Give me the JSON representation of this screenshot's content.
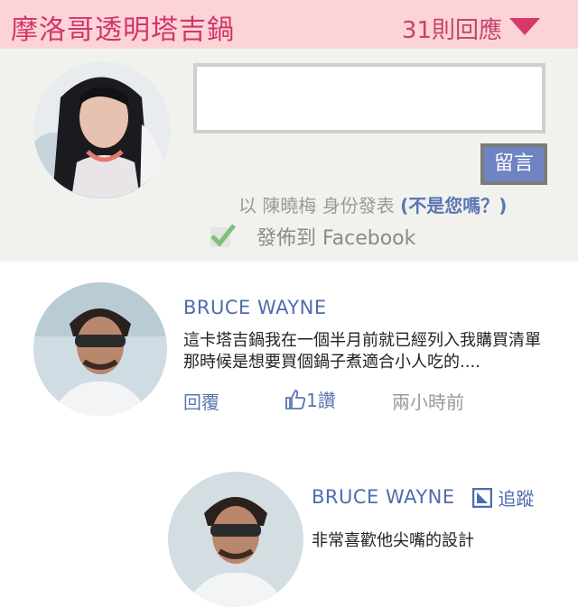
{
  "header": {
    "title": "摩洛哥透明塔吉鍋",
    "comment_count": "31則回應",
    "accent_color": "#d1356c",
    "background_color": "#fcd3d6",
    "caret_icon": "caret-down-icon"
  },
  "compose": {
    "input_value": "",
    "post_label": "留言",
    "identity_prefix": "以 陳曉梅 身份發表",
    "not_you_label": "(不是您嗎？)",
    "facebook_label": "發佈到 Facebook",
    "facebook_checked": true
  },
  "comments": [
    {
      "author": "BRUCE WAYNE",
      "text": "這卡塔吉鍋我在一個半月前就已經列入我購買清單那時候是想要買個鍋子煮適合小人吃的....",
      "reply_label": "回覆",
      "like_label": "1讚",
      "time": "兩小時前"
    },
    {
      "author": "BRUCE WAYNE",
      "follow_label": "追蹤",
      "text": "非常喜歡他尖嘴的設計"
    }
  ]
}
